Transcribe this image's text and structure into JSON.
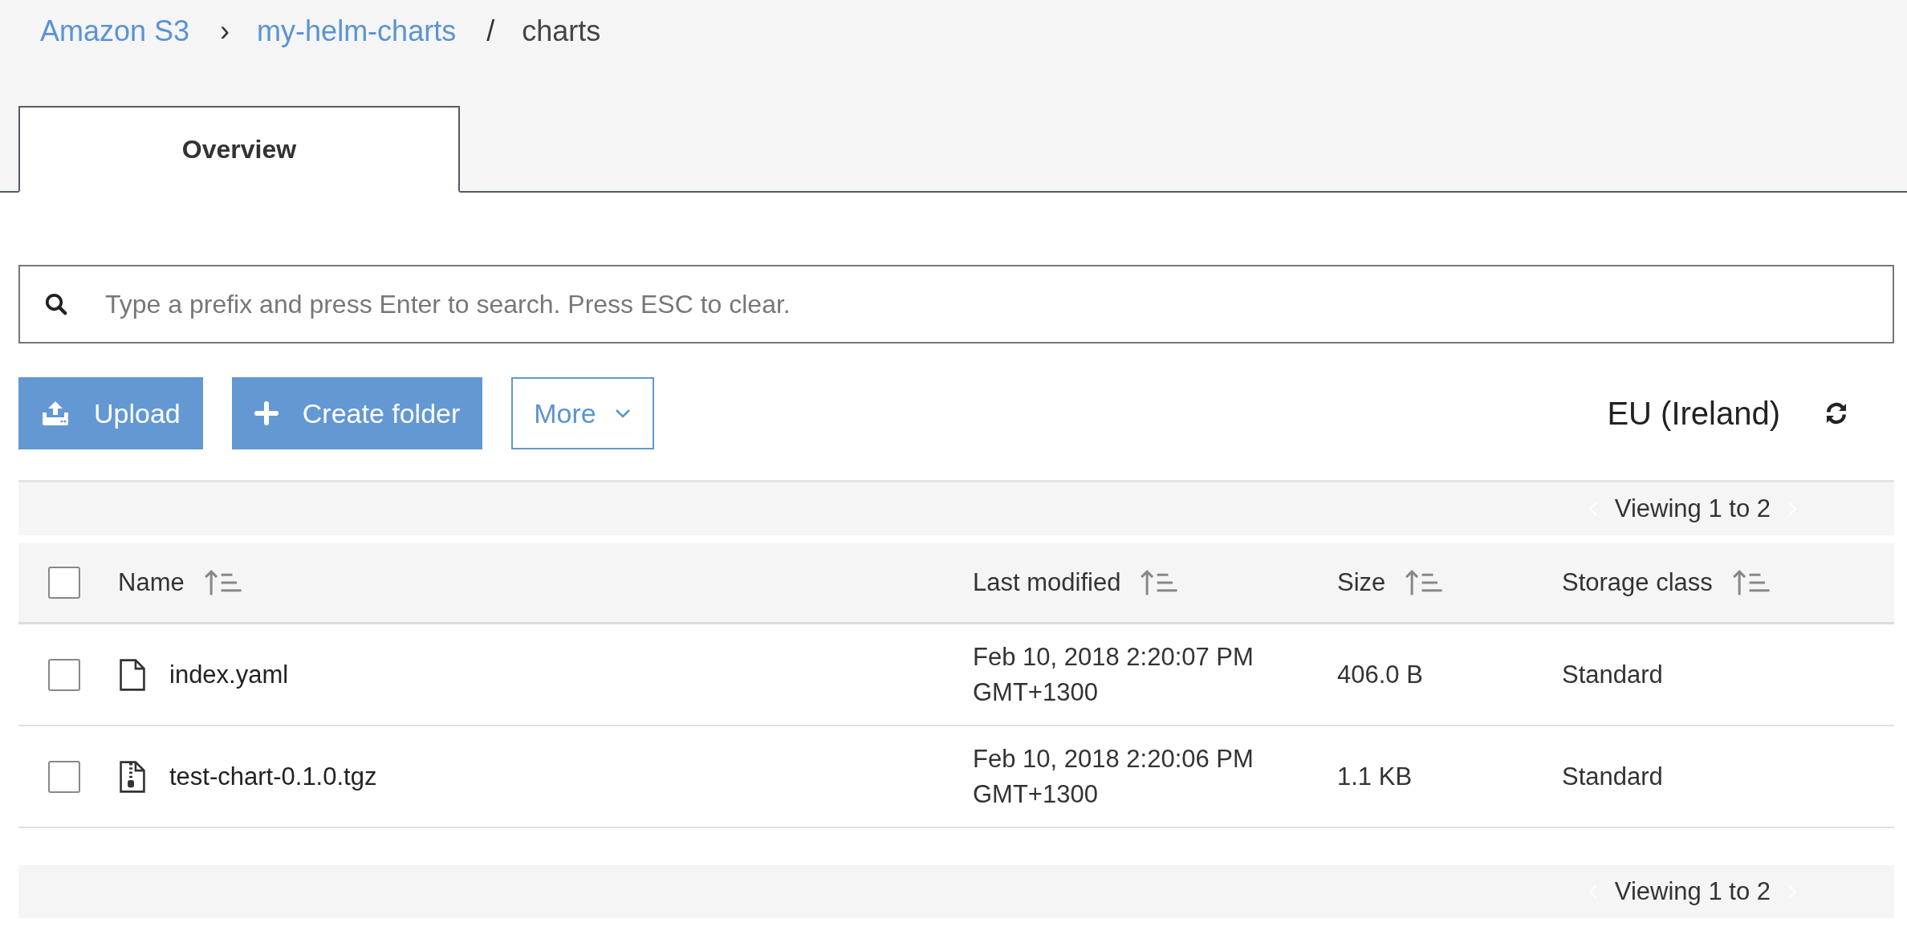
{
  "breadcrumb": [
    {
      "label": "Amazon S3",
      "kind": "link",
      "separator": "›"
    },
    {
      "label": "my-helm-charts",
      "kind": "link",
      "separator": "/"
    },
    {
      "label": "charts",
      "kind": "current"
    }
  ],
  "tabs": [
    {
      "label": "Overview",
      "selected": true
    }
  ],
  "search": {
    "placeholder": "Type a prefix and press Enter to search. Press ESC to clear."
  },
  "toolbar": {
    "buttons": [
      {
        "label": "Upload",
        "kind": "upload"
      },
      {
        "label": "Create folder",
        "kind": "create"
      },
      {
        "label": "More",
        "kind": "more"
      }
    ],
    "region": "EU (Ireland)"
  },
  "pager_top": "Viewing 1 to 2",
  "table": {
    "select_all": {
      "checked": false
    },
    "columns": [
      "Name",
      "Last modified",
      "Size",
      "Storage class"
    ],
    "rows": [
      {
        "checked": false,
        "kind": "file",
        "name": "index.yaml",
        "modified": [
          "Feb 10, 2018 2:20:07 PM",
          "GMT+1300"
        ],
        "size": "406.0 B",
        "storage": "Standard"
      },
      {
        "checked": false,
        "kind": "archive",
        "name": "test-chart-0.1.0.tgz",
        "modified": [
          "Feb 10, 2018 2:20:06 PM",
          "GMT+1300"
        ],
        "size": "1.1 KB",
        "storage": "Standard"
      }
    ]
  },
  "pager_bottom": "Viewing 1 to 2"
}
